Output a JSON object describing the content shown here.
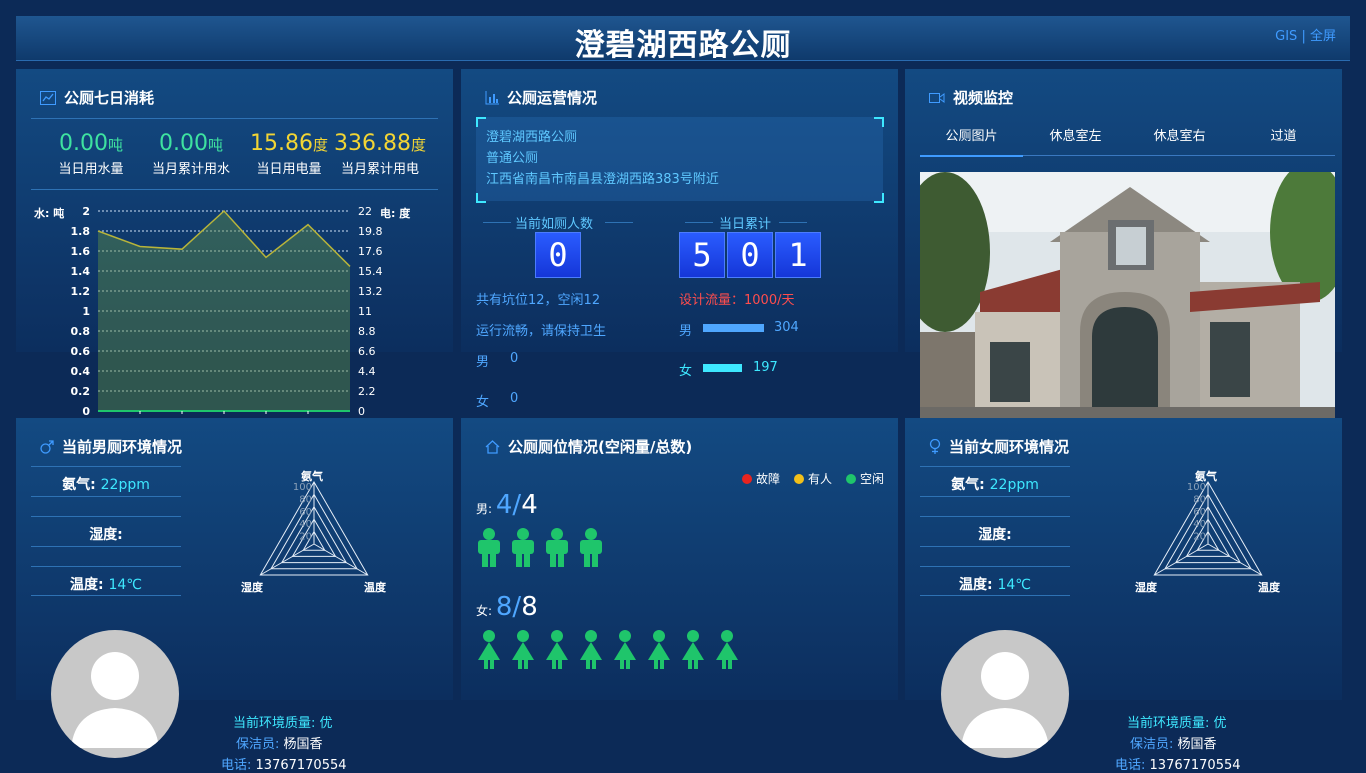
{
  "header": {
    "title": "澄碧湖西路公厕",
    "link_gis": "GIS",
    "separator": "|",
    "link_full": "全屏"
  },
  "consumption": {
    "title": "公厕七日消耗",
    "stats": [
      {
        "value": "0.00",
        "unit": "吨",
        "label": "当日用水量"
      },
      {
        "value": "0.00",
        "unit": "吨",
        "label": "当月累计用水"
      },
      {
        "value": "15.86",
        "unit": "度",
        "label": "当日用电量"
      },
      {
        "value": "336.88",
        "unit": "度",
        "label": "当月累计用电"
      }
    ],
    "chart_data": {
      "type": "area",
      "left_label": "水: 吨",
      "right_label": "电: 度",
      "left_ticks": [
        "2",
        "1.8",
        "1.6",
        "1.4",
        "1.2",
        "1",
        "0.8",
        "0.6",
        "0.4",
        "0.2",
        "0"
      ],
      "right_ticks": [
        "22",
        "19.8",
        "17.6",
        "15.4",
        "13.2",
        "11",
        "8.8",
        "6.6",
        "4.4",
        "2.2",
        "0"
      ],
      "left_ylim": [
        0,
        2
      ],
      "right_ylim": [
        0,
        22
      ],
      "series": [
        {
          "axis": "right",
          "values": [
            19.8,
            18.1,
            17.8,
            22.0,
            16.9,
            20.5,
            15.9
          ]
        },
        {
          "axis": "left",
          "values": [
            0,
            0,
            0,
            0,
            0,
            0,
            0
          ]
        }
      ]
    }
  },
  "operation": {
    "title": "公厕运营情况",
    "info": [
      "澄碧湖西路公厕",
      "普通公厕",
      "江西省南昌市南昌县澄湖西路383号附近"
    ],
    "current_label": "当前如厕人数",
    "current_digits": [
      "0"
    ],
    "today_label": "当日累计",
    "today_digits": [
      "5",
      "0",
      "1"
    ],
    "pits": "共有坑位12，空闲12",
    "status": "运行流畅，请保持卫生",
    "male_label": "男",
    "male_now": "0",
    "female_label": "女",
    "female_now": "0",
    "design_flow": "设计流量：1000/天",
    "male_total": "304",
    "female_total": "197",
    "male_frac": 0.304,
    "female_frac": 0.197
  },
  "video": {
    "title": "视频监控",
    "tabs": [
      "公厕图片",
      "休息室左",
      "休息室右",
      "过道"
    ]
  },
  "male_env": {
    "title": "当前男厕环境情况",
    "ammonia_label": "氨气:",
    "ammonia_value": "22ppm",
    "humidity_label": "湿度:",
    "humidity_value": "",
    "temp_label": "温度:",
    "temp_value": "14℃",
    "radar": {
      "top": "氨气",
      "left": "湿度",
      "right": "温度",
      "ticks": [
        "100",
        "80",
        "60",
        "40",
        "20"
      ]
    },
    "quality": "当前环境质量: 优",
    "cleaner_label": "保洁员:",
    "cleaner": "杨国香",
    "phone_label": "电话:",
    "phone": "13767170554"
  },
  "seats": {
    "title": "公厕厕位情况(空闲量/总数)",
    "legend": [
      {
        "label": "故障",
        "color": "#e8241f"
      },
      {
        "label": "有人",
        "color": "#f2c01b"
      },
      {
        "label": "空闲",
        "color": "#1fc56b"
      }
    ],
    "male_label": "男:",
    "male_free": "4",
    "male_slash": "/",
    "male_total": "4",
    "female_label": "女:",
    "female_free": "8",
    "female_slash": "/",
    "female_total": "8",
    "male_count": 4,
    "female_count": 8,
    "seat_color": "#1fc56b"
  },
  "female_env": {
    "title": "当前女厕环境情况",
    "ammonia_label": "氨气:",
    "ammonia_value": "22ppm",
    "humidity_label": "湿度:",
    "humidity_value": "",
    "temp_label": "温度:",
    "temp_value": "14℃",
    "radar": {
      "top": "氨气",
      "left": "湿度",
      "right": "温度",
      "ticks": [
        "100",
        "80",
        "60",
        "40",
        "20"
      ]
    },
    "quality": "当前环境质量: 优",
    "cleaner_label": "保洁员:",
    "cleaner": "杨国香",
    "phone_label": "电话:",
    "phone": "13767170554"
  }
}
